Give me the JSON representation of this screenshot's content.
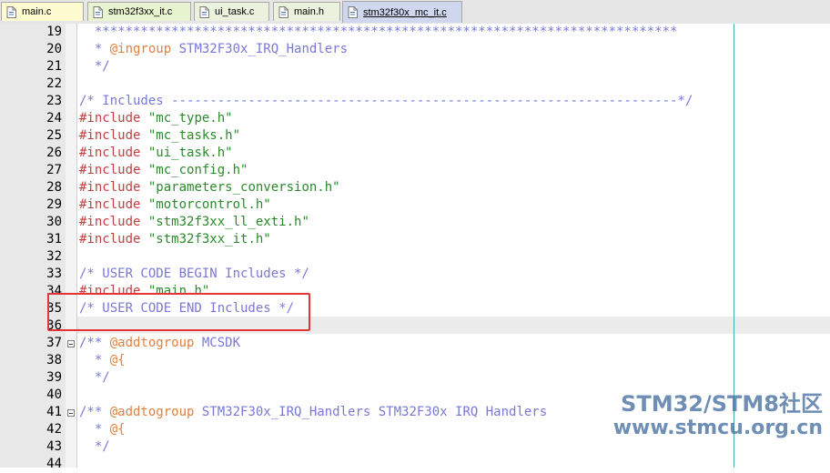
{
  "tabs": [
    {
      "label": "main.c",
      "active": false
    },
    {
      "label": "stm32f3xx_it.c",
      "active": false
    },
    {
      "label": "ui_task.c",
      "active": false
    },
    {
      "label": "main.h",
      "active": false
    },
    {
      "label": "stm32f30x_mc_it.c",
      "active": true
    }
  ],
  "colors": {
    "comment": "#7878d8",
    "doc_tag": "#e08040",
    "preprocessor": "#c04040",
    "string": "#2a8a2a",
    "annotation_box": "#e53434",
    "edge_line": "#3fb0b0"
  },
  "lines": [
    {
      "num": "19",
      "segments": [
        {
          "t": "  ****************************************************************************",
          "c": "comment"
        }
      ]
    },
    {
      "num": "20",
      "segments": [
        {
          "t": "  * ",
          "c": "comment"
        },
        {
          "t": "@ingroup",
          "c": "doc_tag"
        },
        {
          "t": " STM32F30x_IRQ_Handlers",
          "c": "comment"
        }
      ]
    },
    {
      "num": "21",
      "segments": [
        {
          "t": "  */",
          "c": "comment"
        }
      ]
    },
    {
      "num": "22",
      "segments": []
    },
    {
      "num": "23",
      "segments": [
        {
          "t": "/* Includes ------------------------------------------------------------------*/",
          "c": "comment"
        }
      ]
    },
    {
      "num": "24",
      "segments": [
        {
          "t": "#include",
          "c": "preprocessor"
        },
        {
          "t": " \"mc_type.h\"",
          "c": "string"
        }
      ]
    },
    {
      "num": "25",
      "segments": [
        {
          "t": "#include",
          "c": "preprocessor"
        },
        {
          "t": " \"mc_tasks.h\"",
          "c": "string"
        }
      ]
    },
    {
      "num": "26",
      "segments": [
        {
          "t": "#include",
          "c": "preprocessor"
        },
        {
          "t": " \"ui_task.h\"",
          "c": "string"
        }
      ]
    },
    {
      "num": "27",
      "segments": [
        {
          "t": "#include",
          "c": "preprocessor"
        },
        {
          "t": " \"mc_config.h\"",
          "c": "string"
        }
      ]
    },
    {
      "num": "28",
      "segments": [
        {
          "t": "#include",
          "c": "preprocessor"
        },
        {
          "t": " \"parameters_conversion.h\"",
          "c": "string"
        }
      ]
    },
    {
      "num": "29",
      "segments": [
        {
          "t": "#include",
          "c": "preprocessor"
        },
        {
          "t": " \"motorcontrol.h\"",
          "c": "string"
        }
      ]
    },
    {
      "num": "30",
      "segments": [
        {
          "t": "#include",
          "c": "preprocessor"
        },
        {
          "t": " \"stm32f3xx_ll_exti.h\"",
          "c": "string"
        }
      ]
    },
    {
      "num": "31",
      "segments": [
        {
          "t": "#include",
          "c": "preprocessor"
        },
        {
          "t": " \"stm32f3xx_it.h\"",
          "c": "string"
        }
      ]
    },
    {
      "num": "32",
      "segments": []
    },
    {
      "num": "33",
      "segments": [
        {
          "t": "/* USER CODE BEGIN Includes */",
          "c": "comment"
        }
      ]
    },
    {
      "num": "34",
      "segments": [
        {
          "t": "#include",
          "c": "preprocessor"
        },
        {
          "t": " \"main.h\"",
          "c": "string"
        }
      ]
    },
    {
      "num": "35",
      "segments": [
        {
          "t": "/* USER CODE END Includes */",
          "c": "comment"
        }
      ]
    },
    {
      "num": "36",
      "segments": []
    },
    {
      "num": "37",
      "fold": true,
      "segments": [
        {
          "t": "/** ",
          "c": "comment"
        },
        {
          "t": "@addtogroup",
          "c": "doc_tag"
        },
        {
          "t": " MCSDK",
          "c": "comment"
        }
      ]
    },
    {
      "num": "38",
      "segments": [
        {
          "t": "  * ",
          "c": "comment"
        },
        {
          "t": "@{",
          "c": "doc_tag"
        }
      ]
    },
    {
      "num": "39",
      "segments": [
        {
          "t": "  */",
          "c": "comment"
        }
      ]
    },
    {
      "num": "40",
      "segments": []
    },
    {
      "num": "41",
      "fold": true,
      "segments": [
        {
          "t": "/** ",
          "c": "comment"
        },
        {
          "t": "@addtogroup",
          "c": "doc_tag"
        },
        {
          "t": " STM32F30x_IRQ_Handlers STM32F30x IRQ Handlers",
          "c": "comment"
        }
      ]
    },
    {
      "num": "42",
      "segments": [
        {
          "t": "  * ",
          "c": "comment"
        },
        {
          "t": "@{",
          "c": "doc_tag"
        }
      ]
    },
    {
      "num": "43",
      "segments": [
        {
          "t": "  */",
          "c": "comment"
        }
      ]
    },
    {
      "num": "44",
      "segments": []
    }
  ],
  "watermark": {
    "line1": "STM32/STM8社区",
    "line2": "www.stmcu.org.cn"
  }
}
